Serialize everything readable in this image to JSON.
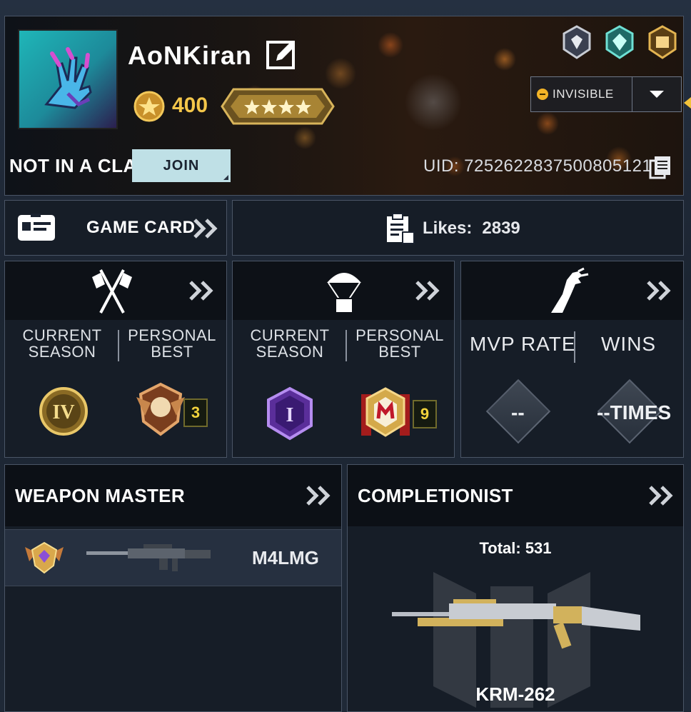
{
  "player": {
    "name": "AoNKiran",
    "coins": "400",
    "clan_status": "NOT IN A CLAN",
    "join_label": "JOIN",
    "uid": "UID: 7252622837500805121",
    "status_label": "INVISIBLE"
  },
  "game_card": {
    "label": "GAME CARD"
  },
  "likes": {
    "label": "Likes:",
    "value": "2839"
  },
  "multiplayer": {
    "col1": "CURRENT SEASON",
    "col2": "PERSONAL BEST",
    "current_rank_icon": "rank-iv-emblem",
    "best_rank_level": "3"
  },
  "battle_royale": {
    "col1": "CURRENT SEASON",
    "col2": "PERSONAL BEST",
    "current_rank_icon": "rank-i-emblem",
    "best_rank_level": "9"
  },
  "zombies": {
    "col1": "MVP RATE",
    "col2": "WINS",
    "mvp_value": "--",
    "wins_value": "--TIMES"
  },
  "weapon_master": {
    "title": "WEAPON MASTER",
    "weapon_name": "M4LMG"
  },
  "completionist": {
    "title": "COMPLETIONIST",
    "total": "Total: 531",
    "weapon_name": "KRM-262"
  },
  "colors": {
    "accent_gold": "#f4c64a",
    "join_bg": "#bfe0e6",
    "status_dot": "#f2b327"
  }
}
